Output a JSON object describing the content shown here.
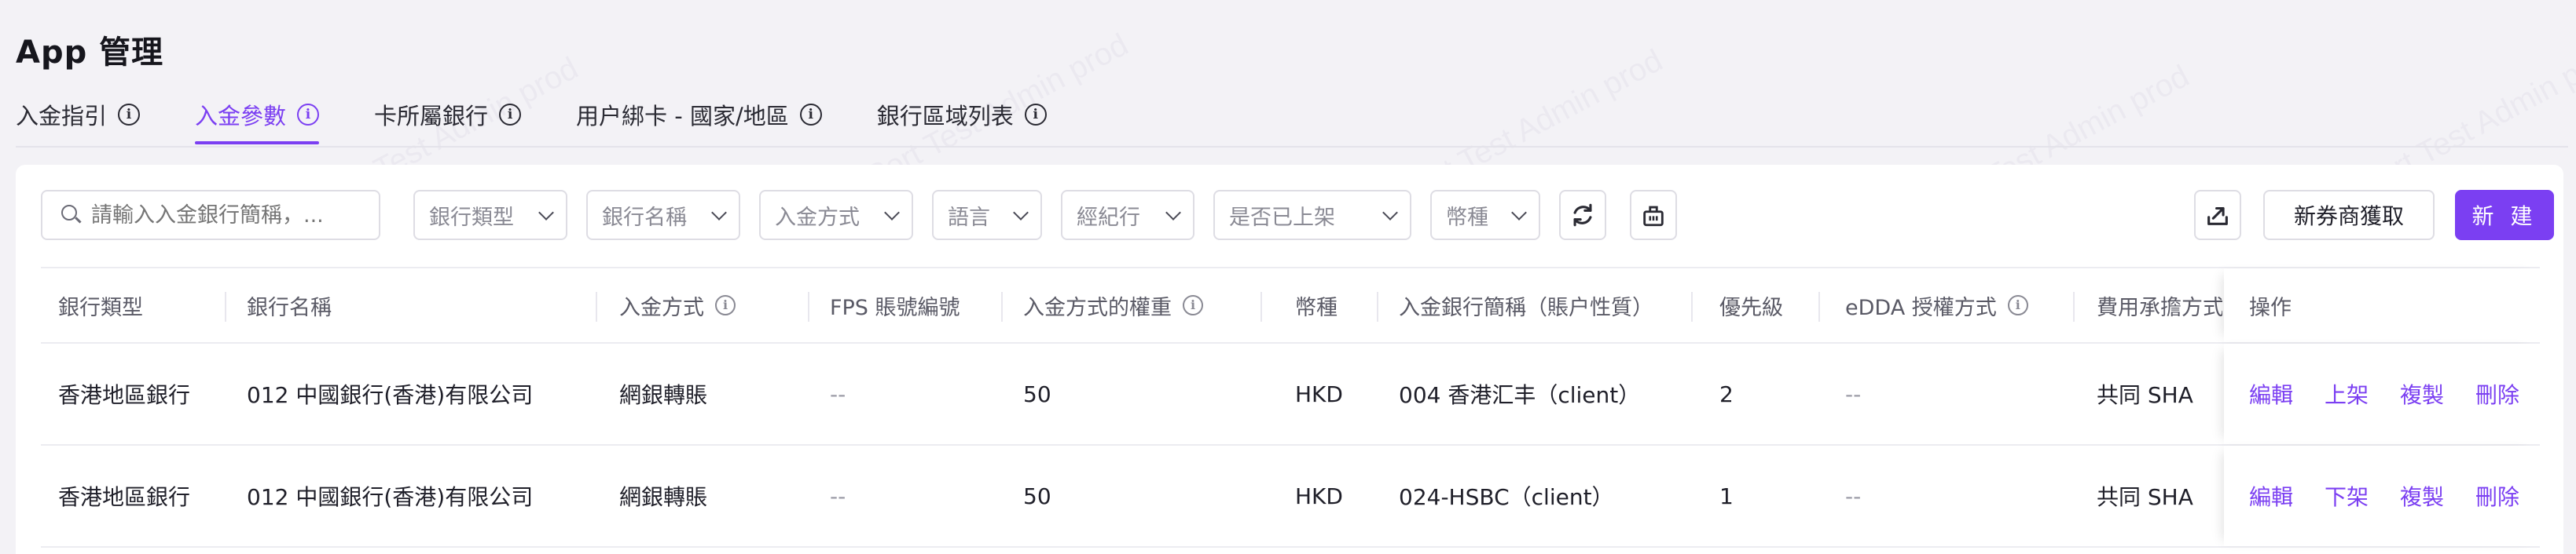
{
  "page": {
    "title": "App 管理"
  },
  "tabs": [
    {
      "label": "入金指引"
    },
    {
      "label": "入金參數"
    },
    {
      "label": "卡所屬銀行"
    },
    {
      "label": "用户綁卡 - 國家/地區"
    },
    {
      "label": "銀行區域列表"
    }
  ],
  "filters": {
    "search_placeholder": "請輸入入金銀行簡稱，...",
    "bank_type": "銀行類型",
    "bank_name": "銀行名稱",
    "deposit_method": "入金方式",
    "language": "語言",
    "broker": "經紀行",
    "listed": "是否已上架",
    "currency": "幣種"
  },
  "actions": {
    "export_icon": "export-icon",
    "new_broker_fetch": "新券商獲取",
    "create": "新 建"
  },
  "table": {
    "headers": {
      "bank_type": "銀行類型",
      "bank_name": "銀行名稱",
      "deposit_method": "入金方式",
      "fps_account": "FPS 賬號編號",
      "method_weight": "入金方式的權重",
      "currency": "幣種",
      "bank_short": "入金銀行簡稱（賬户性質）",
      "priority": "優先級",
      "edda_auth": "eDDA 授權方式",
      "fee_bearer": "費用承擔方式",
      "operations": "操作"
    },
    "rows": [
      {
        "bank_type": "香港地區銀行",
        "bank_name": "012 中國銀行(香港)有限公司",
        "deposit_method": "網銀轉賬",
        "fps_account": "--",
        "method_weight": "50",
        "currency": "HKD",
        "bank_short": "004 香港汇丰（client）",
        "priority": "2",
        "edda_auth": "--",
        "fee_bearer": "共同 SHA",
        "ops": {
          "edit": "編輯",
          "toggle": "上架",
          "copy": "複製",
          "delete": "刪除"
        }
      },
      {
        "bank_type": "香港地區銀行",
        "bank_name": "012 中國銀行(香港)有限公司",
        "deposit_method": "網銀轉賬",
        "fps_account": "--",
        "method_weight": "50",
        "currency": "HKD",
        "bank_short": "024-HSBC（client）",
        "priority": "1",
        "edda_auth": "--",
        "fee_bearer": "共同 SHA",
        "ops": {
          "edit": "編輯",
          "toggle": "下架",
          "copy": "複製",
          "delete": "刪除"
        }
      }
    ]
  },
  "watermark": "LongPort Test Admin prod",
  "colors": {
    "accent": "#7b3ff2",
    "background": "#f3f2f6"
  }
}
